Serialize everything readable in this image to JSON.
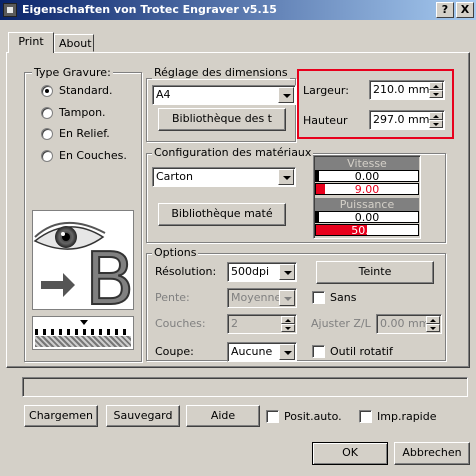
{
  "window": {
    "title": "Eigenschaften von Trotec Engraver v5.15",
    "help_label": "?",
    "close_label": "X"
  },
  "tabs": [
    {
      "label": "Print"
    },
    {
      "label": "About"
    }
  ],
  "type_gravure": {
    "legend": "Type Gravure:",
    "options": [
      {
        "label": "Standard.",
        "selected": true
      },
      {
        "label": "Tampon.",
        "selected": false
      },
      {
        "label": "En Relief.",
        "selected": false
      },
      {
        "label": "En Couches.",
        "selected": false
      }
    ],
    "preview_letter": "B"
  },
  "dimensions": {
    "legend": "Réglage des dimensions",
    "format_value": "A4",
    "library_button": "Bibliothèque des t",
    "largeur_label": "Largeur:",
    "largeur_value": "210.0 mm",
    "hauteur_label": "Hauteur",
    "hauteur_value": "297.0 mm",
    "highlight_color": "#e8001c"
  },
  "materials": {
    "legend": "Configuration des matériaux",
    "material_value": "Carton",
    "library_button": "Bibliothèque maté",
    "vitesse": {
      "label": "Vitesse",
      "values": [
        "0.00",
        "9.00"
      ]
    },
    "puissance": {
      "label": "Puissance",
      "values": [
        "0.00",
        "50.00"
      ]
    }
  },
  "options": {
    "legend": "Options",
    "resolution_label": "Résolution:",
    "resolution_value": "500dpi",
    "teinte_button": "Teinte",
    "pente_label": "Pente:",
    "pente_value": "Moyenne",
    "sans_label": "Sans",
    "couches_label": "Couches:",
    "couches_value": "2",
    "ajuster_label": "Ajuster Z/L",
    "ajuster_value": "0.00 mm",
    "coupe_label": "Coupe:",
    "coupe_value": "Aucune",
    "outil_label": "Outil rotatif"
  },
  "bottom": {
    "chargement": "Chargemen",
    "sauvegard": "Sauvegard",
    "aide": "Aide",
    "posit_auto": "Posit.auto.",
    "imp_rapide": "Imp.rapide",
    "ok": "OK",
    "abbrechen": "Abbrechen"
  }
}
